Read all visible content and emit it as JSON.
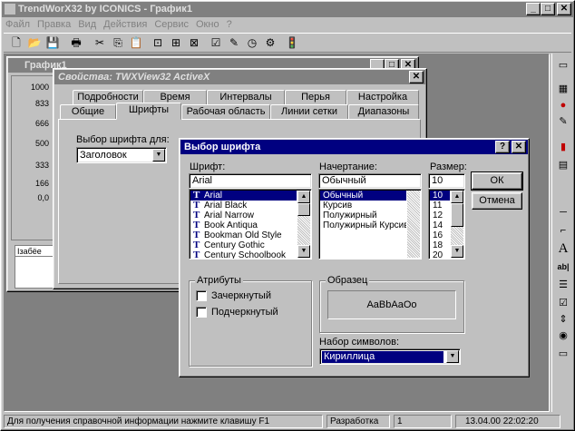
{
  "app": {
    "title": "TrendWorX32 by ICONICS - График1",
    "caption_buttons": {
      "minimize": "_",
      "maximize": "□",
      "close": "✕"
    }
  },
  "menu": [
    "Файл",
    "Правка",
    "Вид",
    "Действия",
    "Сервис",
    "Окно",
    "?"
  ],
  "toolbar": {
    "icons": [
      "new-icon",
      "open-icon",
      "save-icon",
      "print-icon",
      "cut-icon",
      "copy-icon",
      "paste-icon",
      "zoom-window-icon",
      "zoom-fit-icon",
      "zoom-cancel-icon",
      "chart-icon",
      "pens-icon",
      "clock-icon",
      "settings-icon",
      "traffic-light-icon"
    ],
    "glyphs": [
      "🗋",
      "📂",
      "💾",
      "🖶",
      "✂",
      "⎘",
      "📋",
      "⊡",
      "⊞",
      "⊠",
      "☑",
      "✎",
      "◷",
      "⚙",
      "🚦"
    ]
  },
  "chart_window": {
    "title": "График1",
    "y_ticks": [
      "1000",
      "833",
      "666",
      "500",
      "333",
      "166",
      "0,0"
    ],
    "legend_header": "Ізабёе"
  },
  "properties_dialog": {
    "title": "Свойства: TWXView32 ActiveX",
    "tabs_row1": [
      "Подробности",
      "Время",
      "Интервалы",
      "Перья",
      "Настройка"
    ],
    "tabs_row2": [
      "Общие",
      "Шрифты",
      "Рабочая область",
      "Линии сетки",
      "Диапазоны"
    ],
    "active_tab": "Шрифты",
    "font_for_label": "Выбор шрифта для:",
    "font_for_value": "Заголовок"
  },
  "font_dialog": {
    "title": "Выбор шрифта",
    "help": "?",
    "close": "✕",
    "font_label": "Шрифт:",
    "font_value": "Arial",
    "fonts": [
      "Arial",
      "Arial Black",
      "Arial Narrow",
      "Book Antiqua",
      "Bookman Old Style",
      "Century Gothic",
      "Century Schoolbook"
    ],
    "style_label": "Начертание:",
    "style_value": "Обычный",
    "styles": [
      "Обычный",
      "Курсив",
      "Полужирный",
      "Полужирный Курсив"
    ],
    "size_label": "Размер:",
    "size_value": "10",
    "sizes": [
      "10",
      "11",
      "12",
      "14",
      "16",
      "18",
      "20"
    ],
    "ok": "ОК",
    "cancel": "Отмена",
    "attributes_label": "Атрибуты",
    "strikeout": "Зачеркнутый",
    "underline": "Подчеркнутый",
    "sample_label": "Образец",
    "sample_text": "AaBbAaOo",
    "charset_label": "Набор символов:",
    "charset_value": "Кириллица"
  },
  "right_toolbar": {
    "icons": [
      "pointer-icon",
      "window-icon",
      "alarm-icon",
      "edit-icon",
      "report-icon",
      "panel-icon",
      "line-icon",
      "curve-icon",
      "text-icon",
      "label-icon",
      "list-icon",
      "checkbox-icon",
      "spin-icon",
      "radio-icon",
      "button-icon"
    ],
    "glyphs": [
      "▭",
      "▦",
      "●",
      "✎",
      "▮",
      "▤",
      "─",
      "⌐",
      "A",
      "ab|",
      "☰",
      "☑",
      "⇕",
      "◉",
      "▭"
    ]
  },
  "statusbar": {
    "help_text": "Для получения справочной информации нажмите клавишу F1",
    "mode": "Разработка",
    "count": "1",
    "datetime": "13.04.00 22:02:20"
  }
}
